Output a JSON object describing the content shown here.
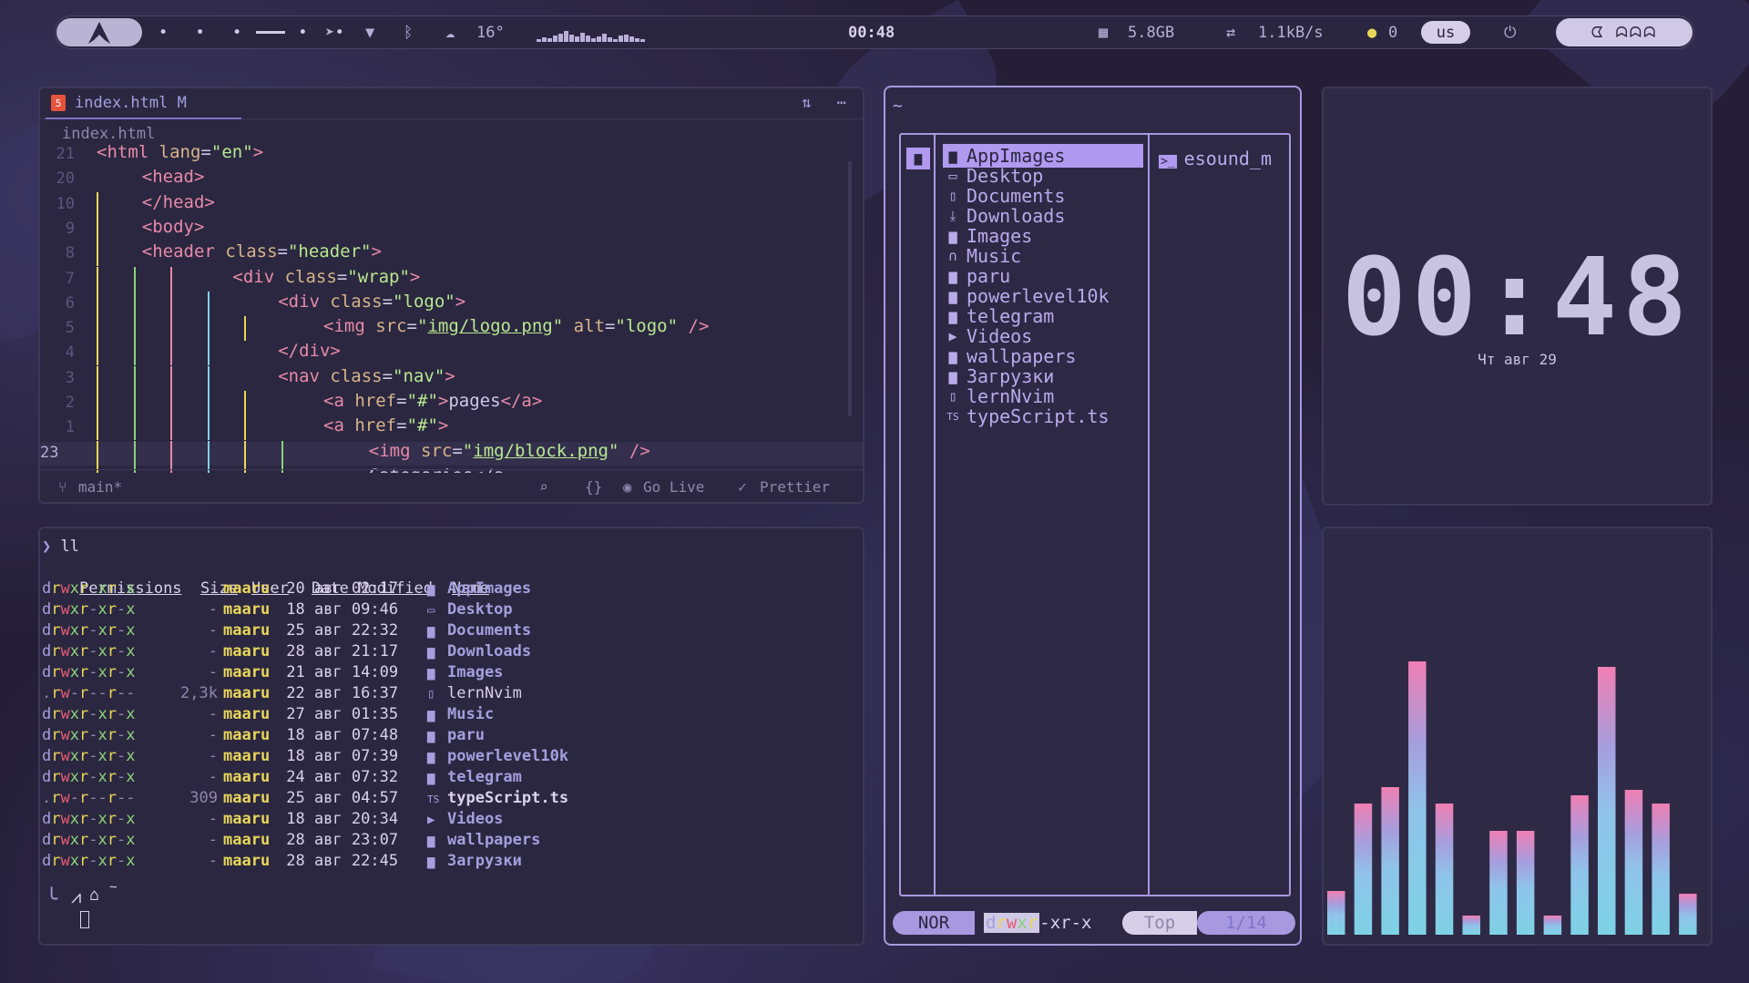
{
  "topbar": {
    "weather": "16°",
    "time": "00:48",
    "memory": "5.8GB",
    "network": "1.1kB/s",
    "updates": "0",
    "layout": "us"
  },
  "editor": {
    "tab_label": "index.html M",
    "breadcrumb": "index.html",
    "lines": [
      {
        "num": "21",
        "html": "<span class='tg'>&lt;html</span> <span class='at'>lang</span>=<span class='st'>\"en\"</span><span class='tg'>&gt;</span>",
        "indent": 0
      },
      {
        "num": "20",
        "html": "<span class='tg'>&lt;head&gt;</span>",
        "indent": 1
      },
      {
        "num": "10",
        "html": "<span class='tg'>&lt;/head&gt;</span>",
        "indent": 1
      },
      {
        "num": "9",
        "html": "<span class='tg'>&lt;body&gt;</span>",
        "indent": 1
      },
      {
        "num": "8",
        "html": "<span class='tg'>&lt;header</span> <span class='at'>class</span>=<span class='st'>\"header\"</span><span class='tg'>&gt;</span>",
        "indent": 1
      },
      {
        "num": "7",
        "html": "<span class='tg'>&lt;div</span> <span class='at'>class</span>=<span class='st'>\"wrap\"</span><span class='tg'>&gt;</span>",
        "indent": 3
      },
      {
        "num": "6",
        "html": "<span class='tg'>&lt;div</span> <span class='at'>class</span>=<span class='st'>\"logo\"</span><span class='tg'>&gt;</span>",
        "indent": 4
      },
      {
        "num": "5",
        "html": "<span class='tg'>&lt;img</span> <span class='at'>src</span>=<span class='st'>\"<span class='u'>img/logo.png</span>\"</span> <span class='at'>alt</span>=<span class='st'>\"logo\"</span> <span class='tg'>/&gt;</span>",
        "indent": 5
      },
      {
        "num": "4",
        "html": "<span class='tg'>&lt;/div&gt;</span>",
        "indent": 4
      },
      {
        "num": "3",
        "html": "<span class='tg'>&lt;nav</span> <span class='at'>class</span>=<span class='st'>\"nav\"</span><span class='tg'>&gt;</span>",
        "indent": 4
      },
      {
        "num": "2",
        "html": "<span class='tg'>&lt;a</span> <span class='at'>href</span>=<span class='st'>\"#\"</span><span class='tg'>&gt;</span>pages<span class='tg'>&lt;/a&gt;</span>",
        "indent": 5
      },
      {
        "num": "1",
        "html": "<span class='tg'>&lt;a</span> <span class='at'>href</span>=<span class='st'>\"#\"</span><span class='tg'>&gt;</span>",
        "indent": 5
      },
      {
        "num": "23",
        "html": "<span class='tg'>&lt;img</span> <span class='at'>src</span>=<span class='st'>\"<span class='u'>img/block.png</span>\"</span> <span class='tg'>/&gt;</span>",
        "indent": 6
      },
      {
        "num": "",
        "html": "Categories&lt;/a",
        "indent": 6
      }
    ],
    "branch": "main*",
    "golive": "Go Live",
    "prettier": "Prettier"
  },
  "terminal": {
    "command": "ll",
    "headers": [
      "Permissions",
      "Size",
      "User",
      "Date Modified",
      "Name"
    ],
    "rows": [
      {
        "perm": "drwxr-xr-x",
        "size": "-",
        "user": "maaru",
        "date": "20 авг 02:17",
        "icon": "folder",
        "name": "AppImages"
      },
      {
        "perm": "drwxr-xr-x",
        "size": "-",
        "user": "maaru",
        "date": "18 авг 09:46",
        "icon": "desktop",
        "name": "Desktop"
      },
      {
        "perm": "drwxr-xr-x",
        "size": "-",
        "user": "maaru",
        "date": "25 авг 22:32",
        "icon": "folder",
        "name": "Documents"
      },
      {
        "perm": "drwxr-xr-x",
        "size": "-",
        "user": "maaru",
        "date": "28 авг 21:17",
        "icon": "folder",
        "name": "Downloads"
      },
      {
        "perm": "drwxr-xr-x",
        "size": "-",
        "user": "maaru",
        "date": "21 авг 14:09",
        "icon": "folder",
        "name": "Images"
      },
      {
        "perm": ".rw-r--r--",
        "size": "2,3k",
        "user": "maaru",
        "date": "22 авг 16:37",
        "icon": "file",
        "name": "lernNvim"
      },
      {
        "perm": "drwxr-xr-x",
        "size": "-",
        "user": "maaru",
        "date": "27 авг 01:35",
        "icon": "folder",
        "name": "Music"
      },
      {
        "perm": "drwxr-xr-x",
        "size": "-",
        "user": "maaru",
        "date": "18 авг 07:48",
        "icon": "folder",
        "name": "paru"
      },
      {
        "perm": "drwxr-xr-x",
        "size": "-",
        "user": "maaru",
        "date": "18 авг 07:39",
        "icon": "folder",
        "name": "powerlevel10k"
      },
      {
        "perm": "drwxr-xr-x",
        "size": "-",
        "user": "maaru",
        "date": "24 авг 07:32",
        "icon": "folder",
        "name": "telegram"
      },
      {
        "perm": ".rw-r--r--",
        "size": "309",
        "user": "maaru",
        "date": "25 авг 04:57",
        "icon": "ts",
        "name": "typeScript.ts"
      },
      {
        "perm": "drwxr-xr-x",
        "size": "-",
        "user": "maaru",
        "date": "18 авг 20:34",
        "icon": "video",
        "name": "Videos"
      },
      {
        "perm": "drwxr-xr-x",
        "size": "-",
        "user": "maaru",
        "date": "28 авг 23:07",
        "icon": "folder",
        "name": "wallpapers"
      },
      {
        "perm": "drwxr-xr-x",
        "size": "-",
        "user": "maaru",
        "date": "28 авг 22:45",
        "icon": "folder-open",
        "name": "Загрузки"
      }
    ],
    "prompt_dir": "~"
  },
  "filemanager": {
    "path": "~",
    "items": [
      {
        "icon": "folder",
        "name": "AppImages",
        "selected": true
      },
      {
        "icon": "desktop",
        "name": "Desktop"
      },
      {
        "icon": "document",
        "name": "Documents"
      },
      {
        "icon": "download",
        "name": "Downloads"
      },
      {
        "icon": "folder",
        "name": "Images"
      },
      {
        "icon": "headphones",
        "name": "Music"
      },
      {
        "icon": "folder",
        "name": "paru"
      },
      {
        "icon": "folder",
        "name": "powerlevel10k"
      },
      {
        "icon": "folder",
        "name": "telegram"
      },
      {
        "icon": "video",
        "name": "Videos"
      },
      {
        "icon": "folder",
        "name": "wallpapers"
      },
      {
        "icon": "folder",
        "name": "Загрузки"
      },
      {
        "icon": "file",
        "name": "lernNvim"
      },
      {
        "icon": "ts",
        "name": "typeScript.ts"
      }
    ],
    "preview": "esound_m",
    "mode": "NOR",
    "perm_parts": [
      "d",
      "r",
      "w",
      "x",
      "r",
      "-xr-x"
    ],
    "scroll": "Top",
    "position": "1/14"
  },
  "clock": {
    "time": "00:48",
    "date": "Чт авг 29"
  },
  "visualizer": {
    "levels": [
      0.16,
      0.48,
      0.54,
      1.0,
      0.48,
      0.07,
      0.38,
      0.38,
      0.07,
      0.51,
      0.98,
      0.53,
      0.48,
      0.15
    ],
    "colors": {
      "top": "#f07fb4",
      "mid": "#a69ede",
      "low": "#7ed2e6"
    }
  }
}
